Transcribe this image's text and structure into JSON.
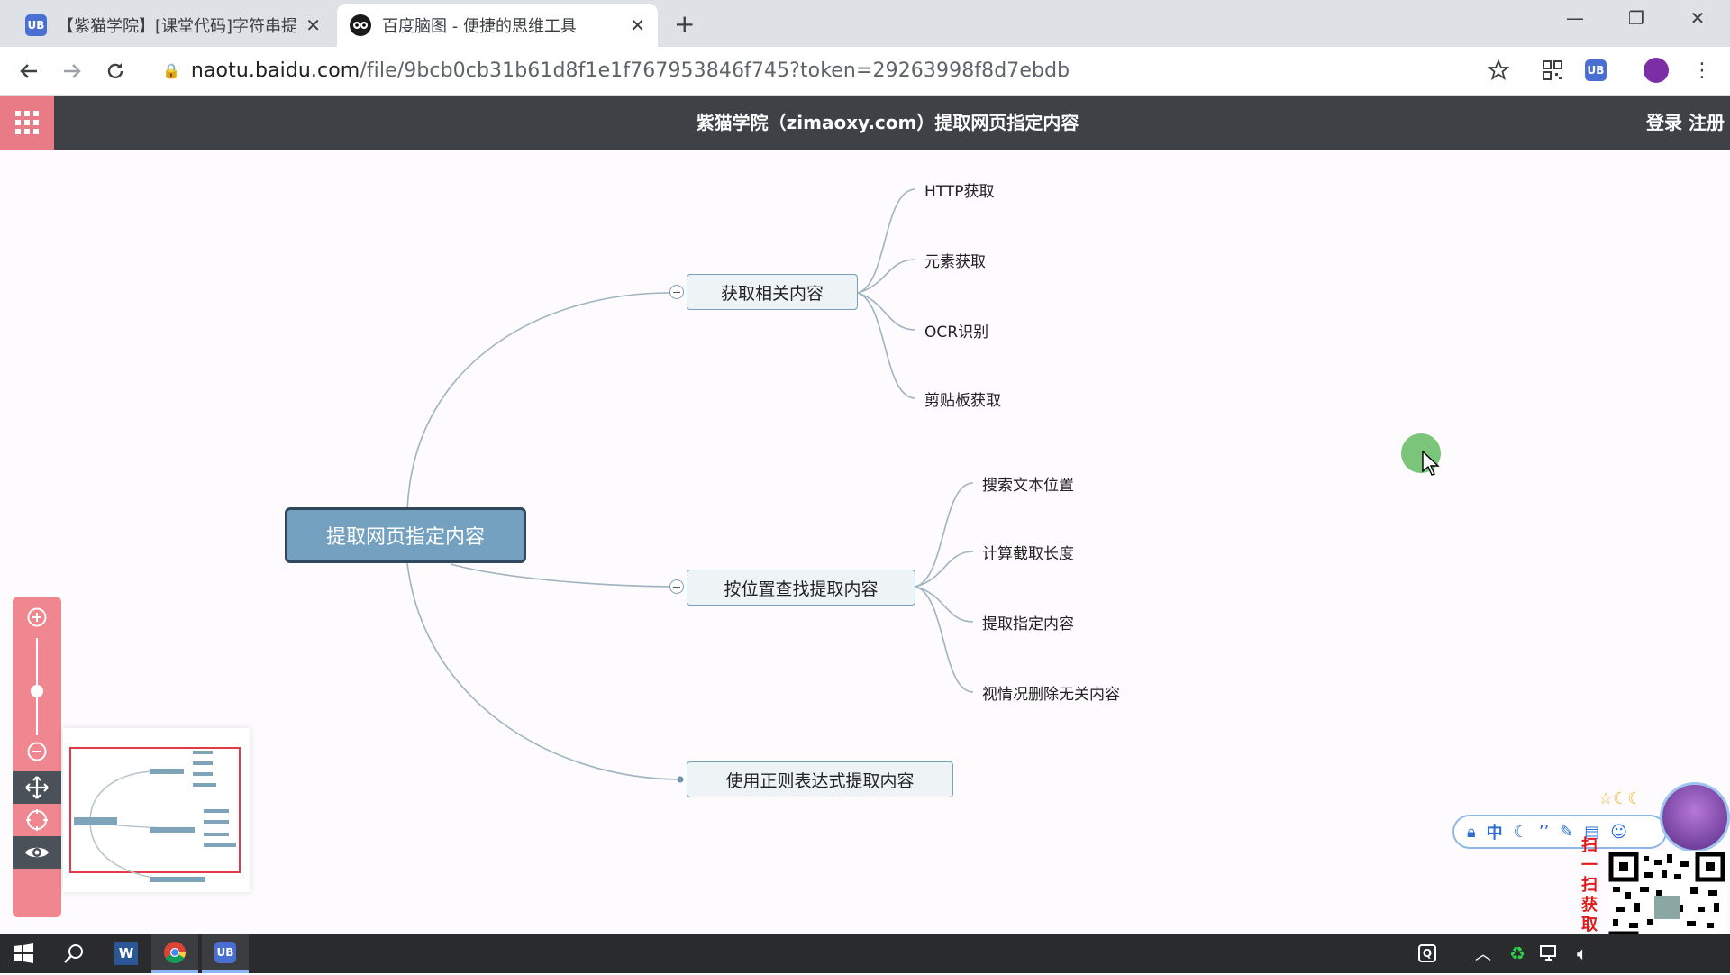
{
  "browser": {
    "tabs": [
      {
        "title": "【紫猫学院】[课堂代码]字符串提",
        "favicon": "UB",
        "active": false
      },
      {
        "title": "百度脑图 - 便捷的思维工具",
        "favicon": "owl",
        "active": true
      }
    ],
    "url_host": "naotu.baidu.com",
    "url_path": "/file/9bcb0cb31b61d8f1e1f767953846f745?token=29263998f8d7ebdb",
    "extension_badge": "UB"
  },
  "app": {
    "title": "紫猫学院（zimaoxy.com）提取网页指定内容",
    "login": "登录",
    "register": "注册",
    "accent_color": "#e97b86",
    "header_color": "#3f4147"
  },
  "mindmap": {
    "root": "提取网页指定内容",
    "branches": [
      {
        "label": "获取相关内容",
        "children": [
          "HTTP获取",
          "元素获取",
          "OCR识别",
          "剪贴板获取"
        ]
      },
      {
        "label": "按位置查找提取内容",
        "children": [
          "搜索文本位置",
          "计算截取长度",
          "提取指定内容",
          "视情况删除无关内容"
        ]
      },
      {
        "label": "使用正则表达式提取内容",
        "children": []
      }
    ]
  },
  "ime": {
    "lang": "中",
    "scan_text": "扫一扫获取教程"
  },
  "taskbar": {
    "icons": [
      "start-icon",
      "search-icon",
      "word-icon",
      "chrome-icon",
      "ub-icon"
    ],
    "tray_icons": [
      "qq-icon",
      "chevron-up-icon",
      "recycle-icon",
      "network-icon",
      "volume-icon"
    ]
  }
}
